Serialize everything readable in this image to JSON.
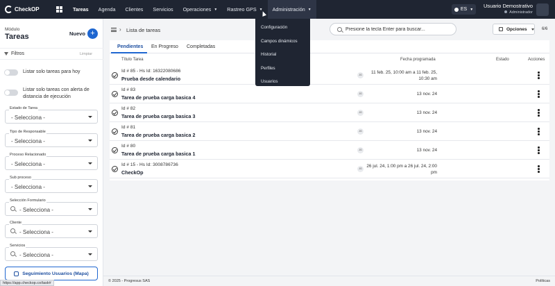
{
  "app": {
    "brand": "CheckOP"
  },
  "nav": {
    "items": [
      {
        "label": "Tareas"
      },
      {
        "label": "Agenda"
      },
      {
        "label": "Clientes"
      },
      {
        "label": "Servicios"
      },
      {
        "label": "Operaciones"
      },
      {
        "label": "Rastreo GPS"
      },
      {
        "label": "Administración"
      }
    ]
  },
  "lang": "ES",
  "user": {
    "name": "Usuario Demostrativo",
    "role": "Administrador"
  },
  "admin_menu": [
    "Configuración",
    "Campos dinámicos",
    "Historial",
    "Perfiles",
    "Usuarios"
  ],
  "sidebar": {
    "module_label": "Módulo",
    "module_title": "Tareas",
    "new_label": "Nuevo",
    "new_icon": "+",
    "filters_label": "Filtros",
    "clear_label": "Limpiar",
    "toggles": [
      {
        "label": "Listar solo tareas para hoy"
      },
      {
        "label": "Listar solo tareas con alerta de distancia de ejecución"
      }
    ],
    "fields": [
      {
        "label": "Estado de Tarea",
        "value": "- Selecciona -"
      },
      {
        "label": "Tipo de Responsable",
        "value": "- Selecciona -"
      },
      {
        "label": "Proceso Relacionado",
        "value": "- Selecciona -"
      },
      {
        "label": "Sub proceso",
        "value": "- Selecciona -"
      },
      {
        "label": "Selección Formulario",
        "value": "- Selecciona -"
      },
      {
        "label": "Cliente",
        "value": "- Selecciona -"
      },
      {
        "label": "Servicios",
        "value": "- Selecciona -"
      }
    ],
    "map_button": "Seguimiento Usuarios (Mapa)"
  },
  "main": {
    "breadcrumb": "Lista de tareas",
    "search_placeholder": "Presione la tecla Enter para buscar...",
    "options_label": "Opciones",
    "count": "6/6",
    "tabs": [
      {
        "label": "Pendientes"
      },
      {
        "label": "En Progreso"
      },
      {
        "label": "Completadas"
      }
    ],
    "columns": {
      "title": "Título Tarea",
      "date": "Fecha programada",
      "status": "Estado",
      "actions": "Acciones"
    },
    "rows": [
      {
        "id": "Id # 85 - Hs Id: 16322080686",
        "name": "Prueba desde calendario",
        "avatar": "JG",
        "date": "11 feb. 25, 10:00 am a 11 feb. 25, 10:30 am"
      },
      {
        "id": "Id # 83",
        "name": "Tarea de prueba carga basica 4",
        "avatar": "JG",
        "date": "13 nov. 24"
      },
      {
        "id": "Id # 82",
        "name": "Tarea de prueba carga basica 3",
        "avatar": "JG",
        "date": "13 nov. 24"
      },
      {
        "id": "Id # 81",
        "name": "Tarea de prueba carga basica 2",
        "avatar": "JG",
        "date": "13 nov. 24"
      },
      {
        "id": "Id # 80",
        "name": "Tarea de prueba carga basica 1",
        "avatar": "JG",
        "date": "13 nov. 24"
      },
      {
        "id": "Id # 15 - Hs Id: 3008786736",
        "name": "CheckOp",
        "avatar": "JG",
        "date": "26 jul. 24, 1:00 pm a 26 jul. 24, 2:00 pm"
      }
    ]
  },
  "footer": {
    "copyright": "© 2025 - Progresus SAS",
    "link": "Políticas"
  },
  "status_url": "https://app.checkop.co/task#",
  "colors": {
    "topbar": "#1f2532",
    "accent": "#1e66d0"
  }
}
